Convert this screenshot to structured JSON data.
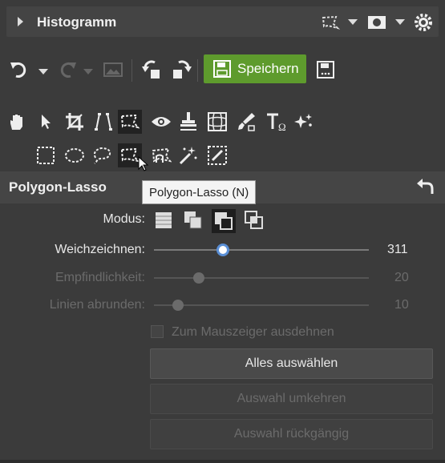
{
  "histogram": {
    "title": "Histogramm"
  },
  "toolbar": {
    "save_label": "Speichern"
  },
  "panel": {
    "title": "Polygon-Lasso",
    "tooltip": "Polygon-Lasso (N)",
    "mode_label": "Modus:",
    "sliders": [
      {
        "label": "Weichzeichnen:",
        "value": "311",
        "enabled": true,
        "level": 0.32
      },
      {
        "label": "Empfindlichkeit:",
        "value": "20",
        "enabled": false,
        "level": 0.2
      },
      {
        "label": "Linien abrunden:",
        "value": "10",
        "enabled": false,
        "level": 0.1
      }
    ],
    "checkbox_label": "Zum Mauszeiger ausdehnen",
    "buttons": {
      "select_all": "Alles auswählen",
      "invert": "Auswahl umkehren",
      "undo": "Auswahl rückgängig"
    }
  },
  "colors": {
    "accent_green": "#5e9b2d",
    "background": "#3b3b3b",
    "slider_thumb": "#5a8fd6"
  },
  "icons": [
    "hand-icon",
    "pointer-icon",
    "crop-icon",
    "perspective-icon",
    "polygon-lasso-icon",
    "eye-icon",
    "clone-stamp-icon",
    "grid-icon",
    "brush-icon",
    "text-icon",
    "sparkle-icon",
    "rect-select-icon",
    "ellipse-select-icon",
    "lasso-icon",
    "polygon-lasso-icon",
    "magnetic-lasso-icon",
    "magic-wand-icon",
    "gradient-select-icon"
  ]
}
